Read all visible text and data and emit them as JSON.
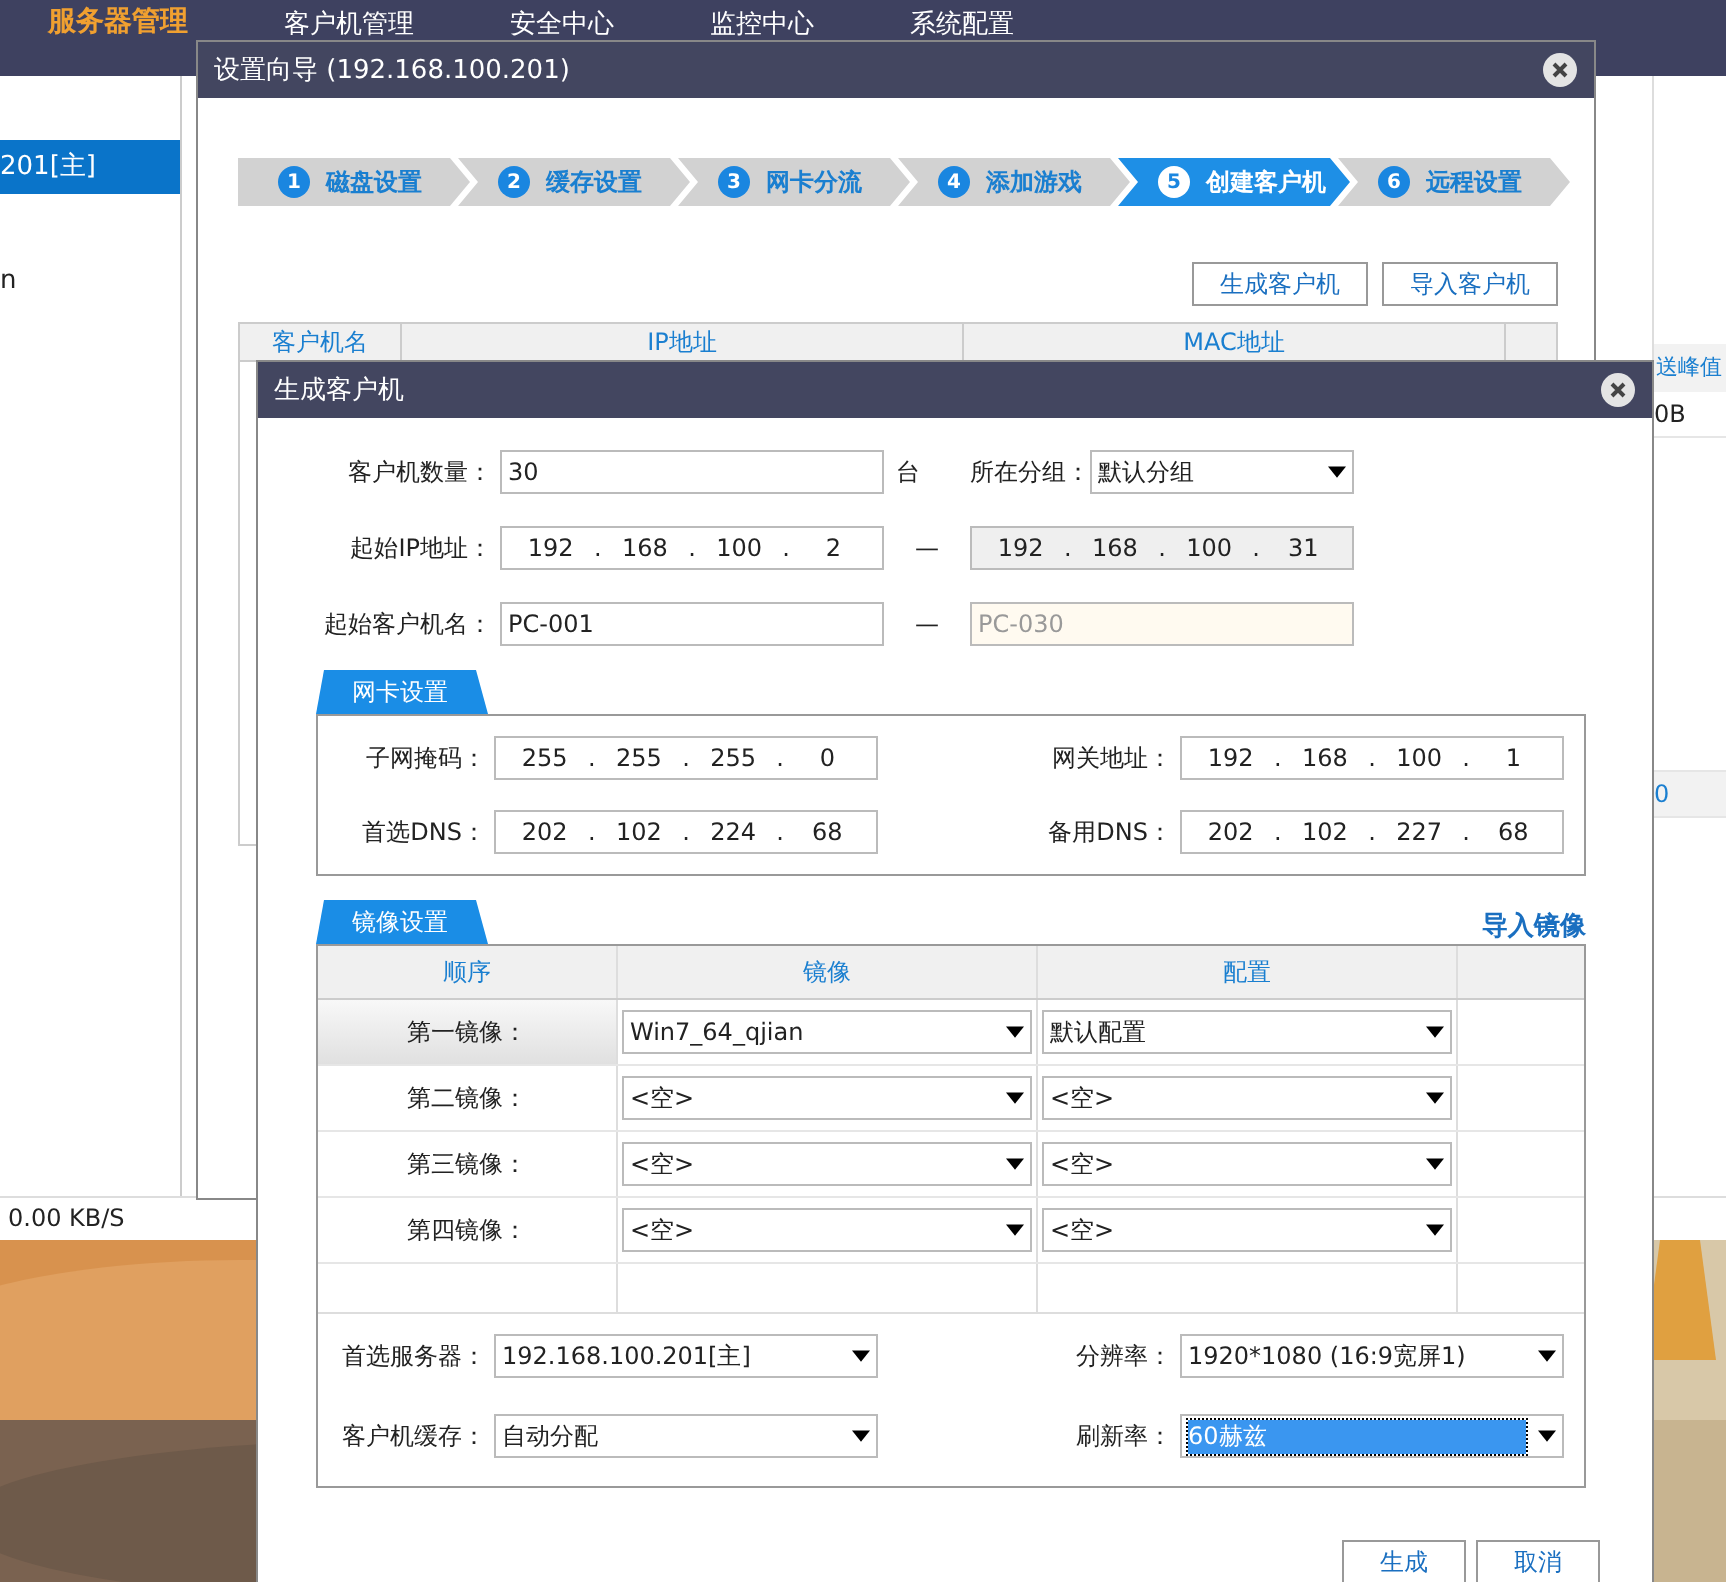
{
  "nav": [
    {
      "label": "服务器管理",
      "selected": true
    },
    {
      "label": "客户机管理",
      "selected": false
    },
    {
      "label": "安全中心",
      "selected": false
    },
    {
      "label": "监控中心",
      "selected": false
    },
    {
      "label": "系统配置",
      "selected": false
    }
  ],
  "sidebar": {
    "items": [
      {
        "label": "201[主]",
        "selected": true
      },
      {
        "label": "n",
        "selected": false
      }
    ]
  },
  "right_panel": {
    "column_header": "送峰值",
    "cells": [
      "0B",
      "0"
    ]
  },
  "status_bar": {
    "speed": "0.00 KB/S"
  },
  "wizard": {
    "title": "设置向导 (192.168.100.201)",
    "steps": [
      {
        "number": "1",
        "label": "磁盘设置",
        "selected": false
      },
      {
        "number": "2",
        "label": "缓存设置",
        "selected": false
      },
      {
        "number": "3",
        "label": "网卡分流",
        "selected": false
      },
      {
        "number": "4",
        "label": "添加游戏",
        "selected": false
      },
      {
        "number": "5",
        "label": "创建客户机",
        "selected": true
      },
      {
        "number": "6",
        "label": "远程设置",
        "selected": false
      }
    ],
    "buttons": [
      "生成客户机",
      "导入客户机"
    ],
    "table": {
      "columns": [
        "客户机名",
        "IP地址",
        "MAC地址"
      ]
    }
  },
  "dialog": {
    "title": "生成客户机",
    "ip_separator": ".",
    "range_dash": "—",
    "count": {
      "label": "客户机数量：",
      "value": "30",
      "unit": "台"
    },
    "group": {
      "label": "所在分组：",
      "value": "默认分组"
    },
    "ranges": [
      {
        "label": "起始IP地址：",
        "start": {
          "kind": "ip",
          "octets": [
            "192",
            "168",
            "100",
            "2"
          ],
          "disabled": false
        },
        "end": {
          "kind": "ip",
          "octets": [
            "192",
            "168",
            "100",
            "31"
          ],
          "disabled": true
        }
      },
      {
        "label": "起始客户机名：",
        "start": {
          "kind": "text",
          "value": "PC-001",
          "disabled": false
        },
        "end": {
          "kind": "text",
          "value": "PC-030",
          "disabled": true
        }
      }
    ],
    "network": {
      "tab": "网卡设置",
      "fields": [
        {
          "label": "子网掩码：",
          "octets": [
            "255",
            "255",
            "255",
            "0"
          ]
        },
        {
          "label": "网关地址：",
          "octets": [
            "192",
            "168",
            "100",
            "1"
          ]
        },
        {
          "label": "首选DNS：",
          "octets": [
            "202",
            "102",
            "224",
            "68"
          ]
        },
        {
          "label": "备用DNS：",
          "octets": [
            "202",
            "102",
            "227",
            "68"
          ]
        }
      ]
    },
    "images": {
      "tab": "镜像设置",
      "link": "导入镜像",
      "columns": [
        "顺序",
        "镜像",
        "配置"
      ],
      "rows": [
        {
          "label": "第一镜像：",
          "image": "Win7_64_qjian",
          "config": "默认配置",
          "selected": true
        },
        {
          "label": "第二镜像：",
          "image": "<空>",
          "config": "<空>",
          "selected": false
        },
        {
          "label": "第三镜像：",
          "image": "<空>",
          "config": "<空>",
          "selected": false
        },
        {
          "label": "第四镜像：",
          "image": "<空>",
          "config": "<空>",
          "selected": false
        }
      ]
    },
    "options": [
      {
        "label": "首选服务器：",
        "value": "192.168.100.201[主]",
        "focused": false
      },
      {
        "label": "分辨率：",
        "value": "1920*1080 (16:9宽屏1)",
        "focused": false
      },
      {
        "label": "客户机缓存：",
        "value": "自动分配",
        "focused": false
      },
      {
        "label": "刷新率：",
        "value": "60赫兹",
        "focused": true
      }
    ],
    "buttons": [
      "生成",
      "取消"
    ]
  }
}
